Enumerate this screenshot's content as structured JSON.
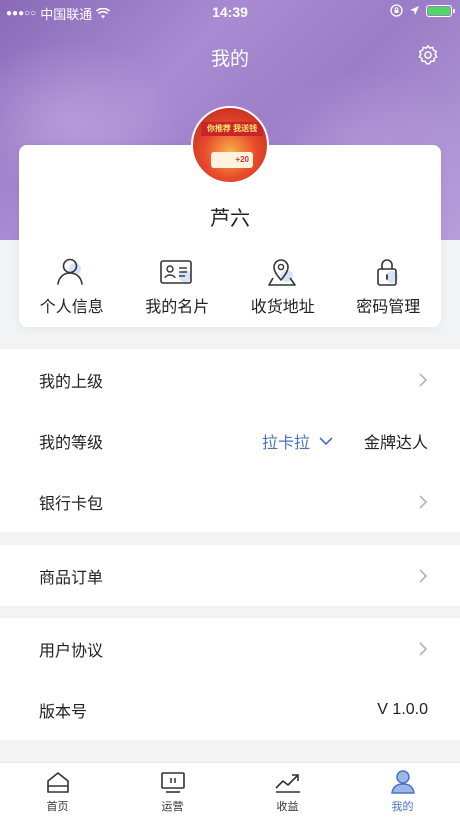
{
  "status_bar": {
    "carrier": "中国联通",
    "time": "14:39"
  },
  "header": {
    "title": "我的",
    "settings_icon": "gear-icon"
  },
  "profile": {
    "avatar_banner": "你推荐 我送钱",
    "avatar_coupon": "+20",
    "name": "芦六"
  },
  "quick_actions": [
    {
      "label": "个人信息",
      "icon": "person-icon"
    },
    {
      "label": "我的名片",
      "icon": "id-card-icon"
    },
    {
      "label": "收货地址",
      "icon": "location-icon"
    },
    {
      "label": "密码管理",
      "icon": "lock-icon"
    }
  ],
  "menu": {
    "superior": "我的上级",
    "level": "我的等级",
    "level_picker": "拉卡拉",
    "level_value": "金牌达人",
    "bank_card": "银行卡包",
    "orders": "商品订单",
    "agreement": "用户协议",
    "version_label": "版本号",
    "version_value": "V 1.0.0"
  },
  "tabbar": [
    {
      "label": "首页",
      "icon": "home-icon"
    },
    {
      "label": "运营",
      "icon": "monitor-icon"
    },
    {
      "label": "收益",
      "icon": "trend-icon"
    },
    {
      "label": "我的",
      "icon": "user-icon",
      "active": true
    }
  ],
  "colors": {
    "accent": "#4a72c4",
    "battery": "#4cd964",
    "background": "#f2f3f5"
  }
}
